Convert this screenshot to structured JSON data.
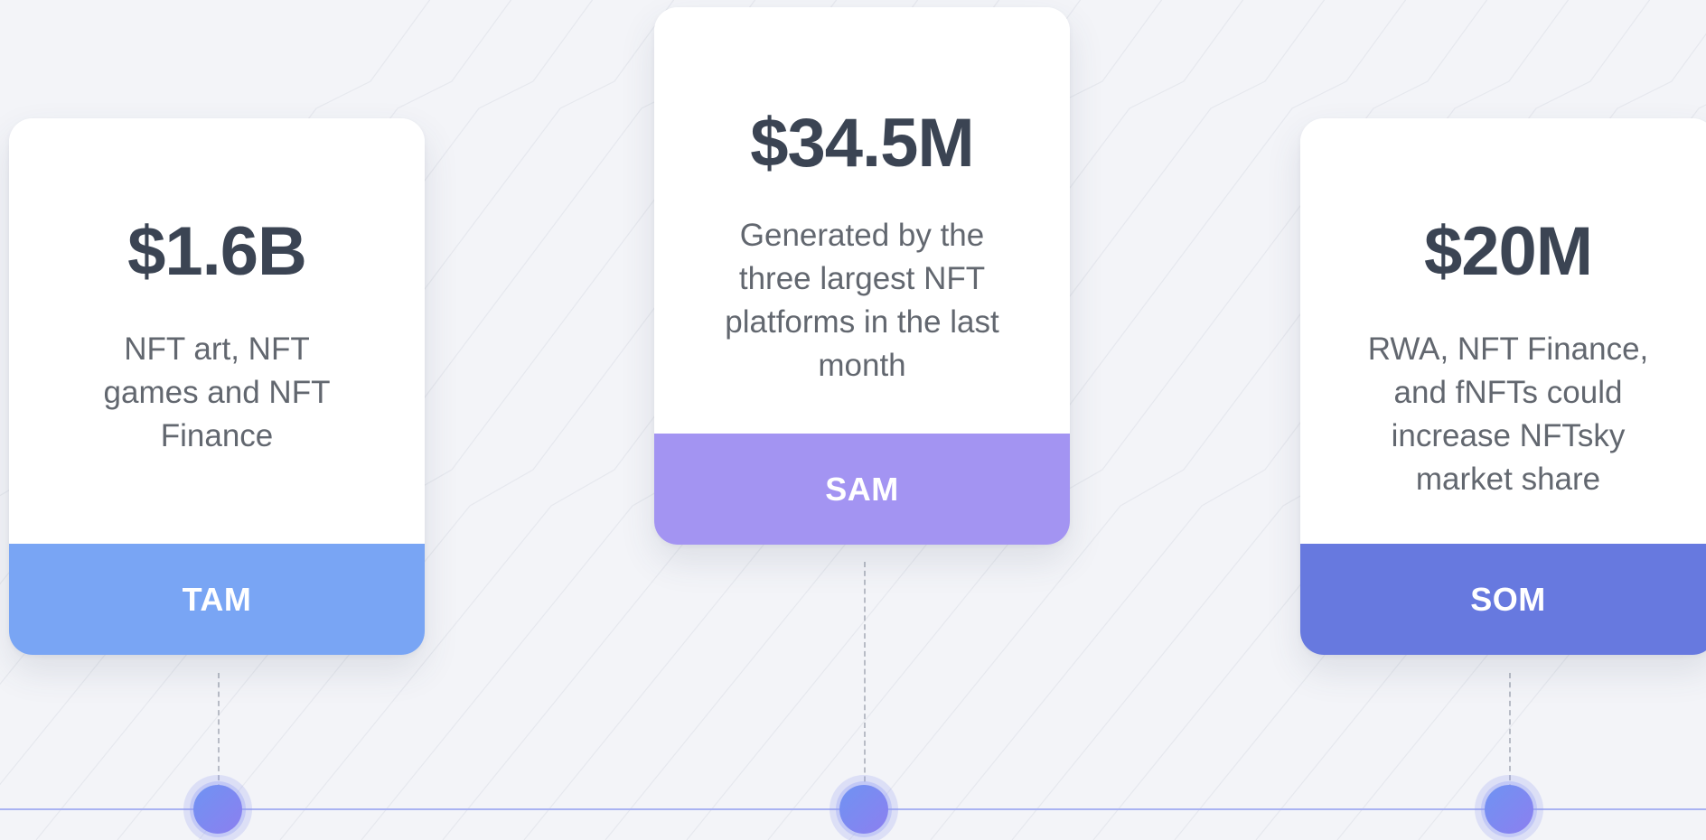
{
  "theme": {
    "tam_color": "#79a5f4",
    "sam_color": "#a394f2",
    "som_color": "#6779df",
    "value_color": "#3b4453",
    "text_color": "#62676f",
    "background": "#f3f4f8"
  },
  "cards": [
    {
      "key": "tam",
      "value": "$1.6B",
      "description_lines": [
        "NFT art, NFT",
        "games and NFT",
        "Finance"
      ],
      "label": "TAM"
    },
    {
      "key": "sam",
      "value": "$34.5M",
      "description_lines": [
        "Generated by the",
        "three largest NFT",
        "platforms in the last",
        "month"
      ],
      "label": "SAM"
    },
    {
      "key": "som",
      "value": "$20M",
      "description_lines": [
        "RWA, NFT Finance,",
        "and fNFTs could",
        "increase NFTsky",
        "market share"
      ],
      "label": "SOM"
    }
  ]
}
